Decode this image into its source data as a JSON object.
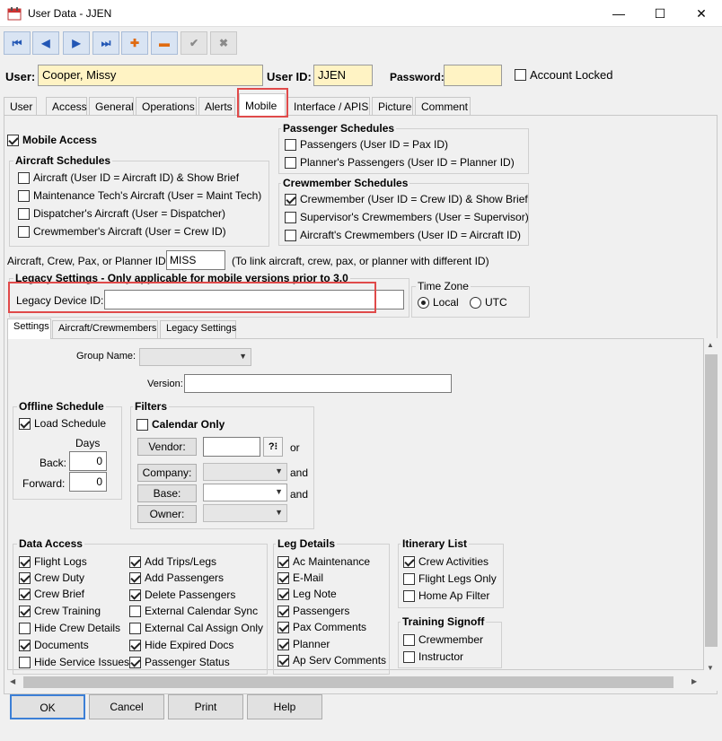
{
  "window": {
    "title": "User Data - JJEN",
    "min": "—",
    "max": "☐",
    "close": "✕"
  },
  "toolbar": {
    "first": "⏮",
    "prev": "◀",
    "next": "▶",
    "last": "⏭",
    "add": "✚",
    "remove": "▬",
    "confirm": "✔",
    "cancel": "✖"
  },
  "header": {
    "user_label": "User:",
    "user_value": "Cooper, Missy",
    "userid_label": "User ID:",
    "userid_value": "JJEN",
    "password_label": "Password:",
    "password_value": "",
    "account_locked": "Account Locked"
  },
  "tabs": [
    "User",
    "Access",
    "General",
    "Operations",
    "Alerts",
    "Mobile",
    "Interface / APIS",
    "Picture",
    "Comment"
  ],
  "mobile": {
    "mobile_access": "Mobile Access",
    "aircraft_schedules": {
      "title": "Aircraft Schedules",
      "items": [
        {
          "label": "Aircraft (User ID = Aircraft ID) & Show Brief",
          "checked": false
        },
        {
          "label": "Maintenance Tech's Aircraft (User = Maint Tech)",
          "checked": false
        },
        {
          "label": "Dispatcher's Aircraft (User = Dispatcher)",
          "checked": false
        },
        {
          "label": "Crewmember's Aircraft (User = Crew ID)",
          "checked": false
        }
      ]
    },
    "passenger_schedules": {
      "title": "Passenger Schedules",
      "items": [
        {
          "label": "Passengers (User ID = Pax ID)",
          "checked": false
        },
        {
          "label": "Planner's Passengers (User ID = Planner ID)",
          "checked": false
        }
      ]
    },
    "crewmember_schedules": {
      "title": "Crewmember Schedules",
      "items": [
        {
          "label": "Crewmember (User ID = Crew ID) & Show Brief",
          "checked": true
        },
        {
          "label": "Supervisor's Crewmembers (User = Supervisor)",
          "checked": false
        },
        {
          "label": "Aircraft's Crewmembers (User ID = Aircraft ID)",
          "checked": false
        }
      ]
    },
    "link_label": "Aircraft, Crew, Pax, or Planner ID:",
    "link_value": "MISS",
    "link_note": "(To link aircraft, crew, pax, or planner with different ID)",
    "legacy_title": "Legacy Settings - Only applicable for mobile versions prior to 3.0",
    "legacy_device_label": "Legacy Device ID:",
    "legacy_device_value": "",
    "timezone": {
      "title": "Time Zone",
      "local": "Local",
      "utc": "UTC"
    }
  },
  "subtabs": [
    "Settings",
    "Aircraft/Crewmembers",
    "Legacy Settings"
  ],
  "settings": {
    "group_name_label": "Group Name:",
    "version_label": "Version:",
    "offline": {
      "title": "Offline Schedule",
      "load": "Load Schedule",
      "days": "Days",
      "back_label": "Back:",
      "back_value": "0",
      "forward_label": "Forward:",
      "forward_value": "0"
    },
    "filters": {
      "title": "Filters",
      "calendar_only": "Calendar Only",
      "vendor": "Vendor:",
      "or": "or",
      "company": "Company:",
      "base": "Base:",
      "owner": "Owner:",
      "and1": "and",
      "and2": "and",
      "lookup": "?⁝"
    },
    "data_access": {
      "title": "Data Access",
      "col1": [
        {
          "label": "Flight Logs",
          "checked": true
        },
        {
          "label": "Crew Duty",
          "checked": true
        },
        {
          "label": "Crew Brief",
          "checked": true
        },
        {
          "label": "Crew Training",
          "checked": true
        },
        {
          "label": "Hide Crew Details",
          "checked": false
        },
        {
          "label": "Documents",
          "checked": true
        },
        {
          "label": "Hide Service Issues",
          "checked": false
        }
      ],
      "col2": [
        {
          "label": "Add Trips/Legs",
          "checked": true
        },
        {
          "label": "Add Passengers",
          "checked": true
        },
        {
          "label": "Delete Passengers",
          "checked": true
        },
        {
          "label": "External Calendar Sync",
          "checked": false
        },
        {
          "label": "External Cal Assign Only",
          "checked": false
        },
        {
          "label": "Hide Expired Docs",
          "checked": true
        },
        {
          "label": "Passenger Status",
          "checked": true
        }
      ]
    },
    "leg_details": {
      "title": "Leg Details",
      "items": [
        {
          "label": "Ac Maintenance",
          "checked": true
        },
        {
          "label": "E-Mail",
          "checked": true
        },
        {
          "label": "Leg Note",
          "checked": true
        },
        {
          "label": "Passengers",
          "checked": true
        },
        {
          "label": "Pax Comments",
          "checked": true
        },
        {
          "label": "Planner",
          "checked": true
        },
        {
          "label": "Ap Serv Comments",
          "checked": true
        }
      ]
    },
    "itinerary": {
      "title": "Itinerary List",
      "items": [
        {
          "label": "Crew Activities",
          "checked": true
        },
        {
          "label": "Flight Legs Only",
          "checked": false
        },
        {
          "label": "Home Ap Filter",
          "checked": false
        }
      ]
    },
    "training": {
      "title": "Training Signoff",
      "items": [
        {
          "label": "Crewmember",
          "checked": false
        },
        {
          "label": "Instructor",
          "checked": false
        }
      ]
    }
  },
  "buttons": {
    "ok": "OK",
    "cancel": "Cancel",
    "print": "Print",
    "help": "Help"
  },
  "colors": {
    "highlight": "#e04a4a",
    "yellow_field": "#fff3c4",
    "toolbar_blue": "#2357b5"
  }
}
